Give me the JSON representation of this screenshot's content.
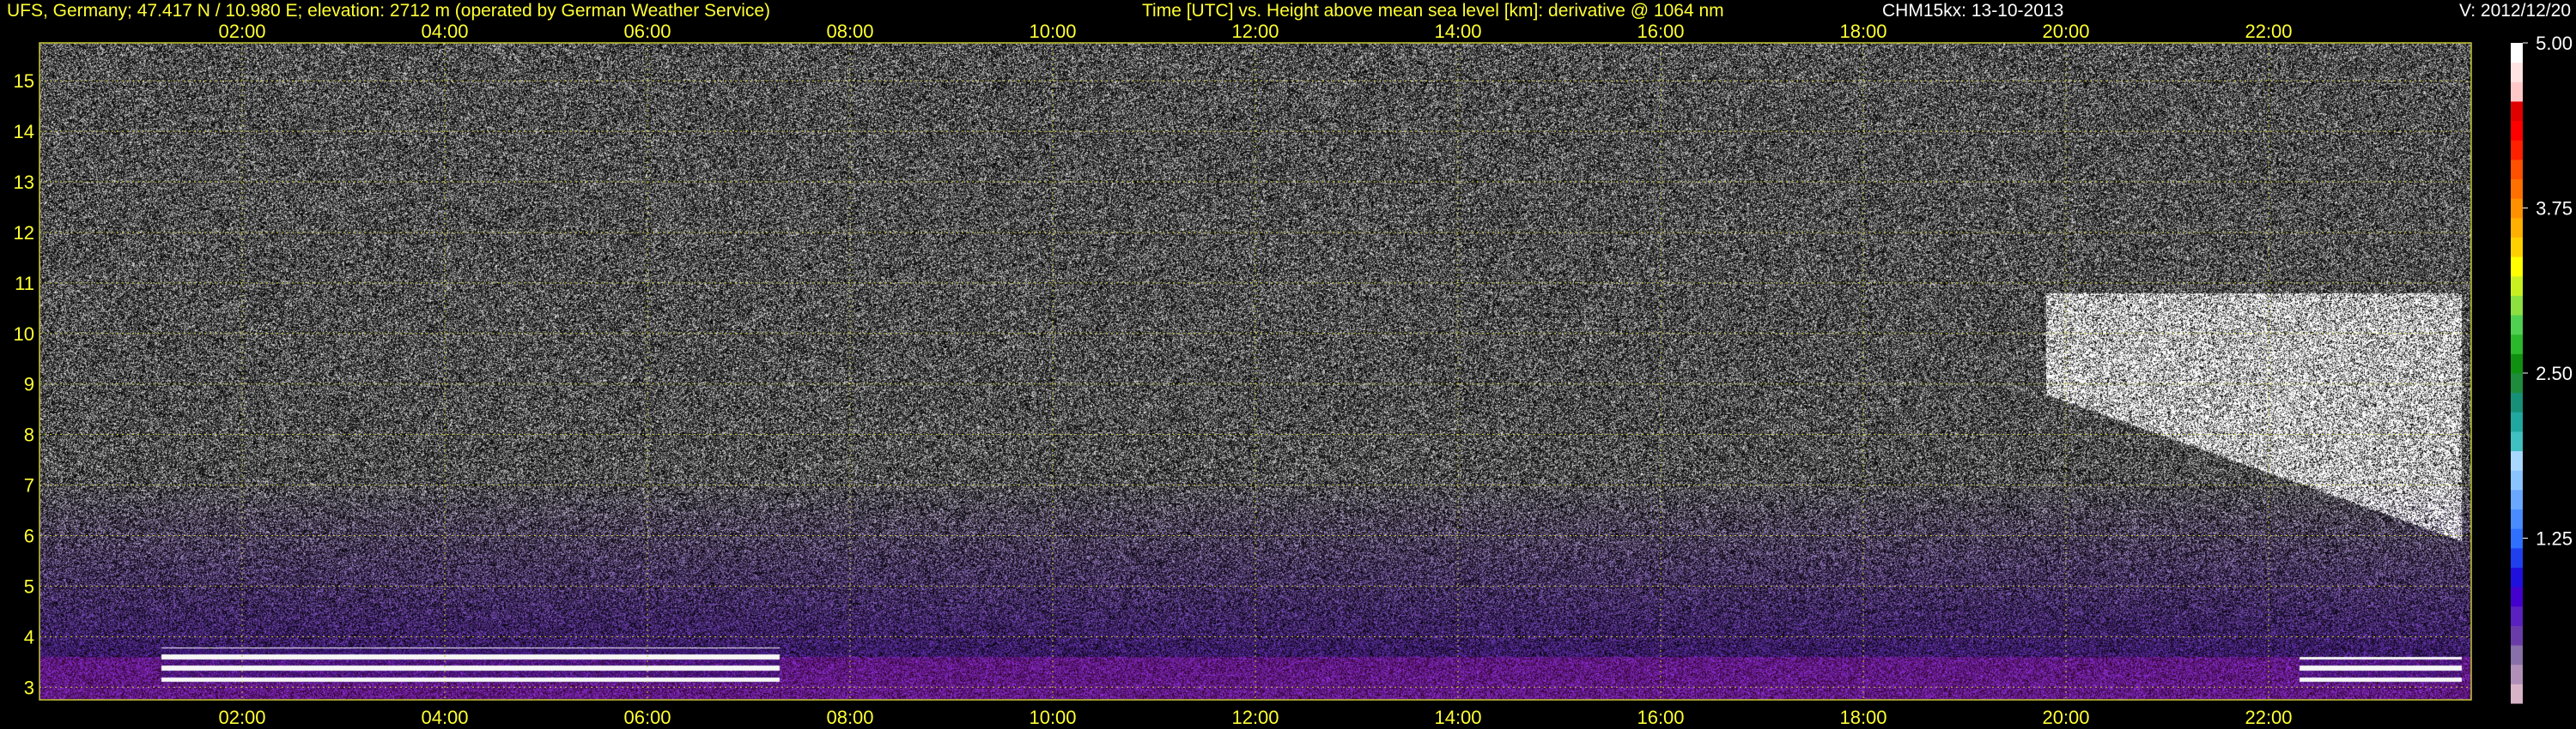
{
  "header": {
    "station": "UFS, Germany; 47.417 N / 10.980 E; elevation: 2712 m  (operated by German Weather Service)",
    "description": "Time [UTC] vs. Height above mean sea level [km]: derivative @ 1064 nm",
    "instrument": "CHM15kx: 13-10-2013",
    "version": "V: 2012/12/20"
  },
  "colors": {
    "background": "#000000",
    "header_text": "#ffff33",
    "header_text_alt": "#ffffff",
    "grid": "#c8c832",
    "axis_text": "#ffff33",
    "colorbar_text": "#ffffff"
  },
  "chart_data": {
    "type": "heatmap",
    "xlabel": "Time [UTC]",
    "ylabel": "Height above mean sea level [km]",
    "quantity": "derivative @ 1064 nm",
    "x_ticks": [
      "02:00",
      "04:00",
      "06:00",
      "08:00",
      "10:00",
      "12:00",
      "14:00",
      "16:00",
      "18:00",
      "20:00",
      "22:00"
    ],
    "x_range_hours": [
      0,
      24
    ],
    "y_ticks": [
      3,
      4,
      5,
      6,
      7,
      8,
      9,
      10,
      11,
      12,
      13,
      14,
      15
    ],
    "y_range_km": [
      2.75,
      15.75
    ],
    "grid": true,
    "colorbar": {
      "range": [
        0,
        5.0
      ],
      "tick_labels": [
        "5.00",
        "3.75",
        "2.50",
        "1.25"
      ],
      "tick_values": [
        5.0,
        3.75,
        2.5,
        1.25
      ],
      "colors": [
        "#d8b4c8",
        "#b090b8",
        "#8870a8",
        "#6a3ca8",
        "#5a20c0",
        "#4400cc",
        "#2010dd",
        "#2040ee",
        "#3070ff",
        "#4a8cff",
        "#6aa8ff",
        "#8ac4ff",
        "#a8d8ff",
        "#40c0c0",
        "#20a8a0",
        "#189078",
        "#1e8c3c",
        "#109010",
        "#2cb82c",
        "#50d050",
        "#8ce040",
        "#c8f020",
        "#ffff00",
        "#ffd000",
        "#ffb000",
        "#ff9000",
        "#ff7000",
        "#ff5000",
        "#ff2000",
        "#ff0000",
        "#e00000",
        "#ffc8c8",
        "#ffe4e4",
        "#ffffff"
      ]
    },
    "features": [
      {
        "name": "cloud-top-right",
        "time_start_h": 19.8,
        "time_end_h": 23.9,
        "height_low_km": 5.9,
        "height_high_km": 10.8
      },
      {
        "name": "low-layer-morning",
        "time_start_h": 1.2,
        "time_end_h": 7.3,
        "height_low_km": 3.1,
        "height_high_km": 3.8
      },
      {
        "name": "low-layer-evening",
        "time_start_h": 22.3,
        "time_end_h": 23.9,
        "height_low_km": 3.1,
        "height_high_km": 3.6
      }
    ]
  }
}
